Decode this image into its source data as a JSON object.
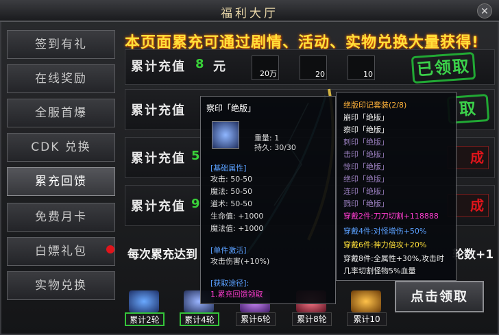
{
  "window": {
    "title": "福利大厅",
    "close_label": "✕"
  },
  "sidebar": {
    "items": [
      {
        "label": "签到有礼"
      },
      {
        "label": "在线奖励"
      },
      {
        "label": "全服首爆"
      },
      {
        "label": "CDK 兑换"
      },
      {
        "label": "累充回馈"
      },
      {
        "label": "免费月卡"
      },
      {
        "label": "白嫖礼包"
      },
      {
        "label": "实物兑换"
      }
    ],
    "active_index": 4
  },
  "banner": "本页面累充可通过剧情、活动、实物兑换大量获得!",
  "rows": [
    {
      "label": "累计充值",
      "amount": "8",
      "unit": "元",
      "items": [
        "20万",
        "20",
        "10"
      ],
      "status": "已领取"
    },
    {
      "label": "累计充值",
      "status": "取"
    },
    {
      "label": "累计充值",
      "amount": "5",
      "status": "成"
    },
    {
      "label": "累计充值",
      "amount": "9",
      "status": "成"
    }
  ],
  "bottom": {
    "left": "每次累充达到",
    "right": "轮数+1"
  },
  "rewards": [
    "累计2轮",
    "累计4轮",
    "累计6轮",
    "累计8轮",
    "累计10"
  ],
  "claim_label": "点击领取",
  "tooltip_item": {
    "name": "察印「绝版」",
    "weight": "重量: 1",
    "durability": "持久: 30/30",
    "section_basic": "[基础属性]",
    "stats": [
      "攻击: 50-50",
      "魔法: 50-50",
      "道术: 50-50",
      "生命值: +1000",
      "魔法值: +1000"
    ],
    "section_activate": "[单件激活]",
    "activate": "攻击伤害(+10%)",
    "section_source": "[获取途径]:",
    "source": "1.累充回馈领取"
  },
  "tooltip_set": {
    "title": "绝版印记套装(2/8)",
    "pieces": [
      "崩印「绝版」",
      "察印「绝版」",
      "刺印「绝版」",
      "击印「绝版」",
      "惊印「绝版」",
      "绝印「绝版」",
      "连印「绝版」",
      "戮印「绝版」"
    ],
    "b2": "穿戴2件:刀刀切割+118888",
    "b4": "穿戴4件:对怪增伤+50%",
    "b6": "穿戴6件:神力倍攻+20%",
    "b8a": "穿戴8件:全属性+30%,攻击时",
    "b8b": "几率切割怪物5%血量"
  }
}
